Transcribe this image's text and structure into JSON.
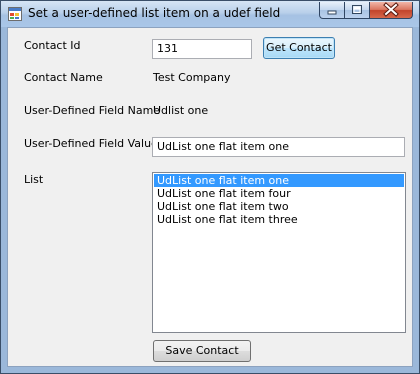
{
  "window": {
    "title": "Set a user-defined list item on a udef field",
    "icon": "app-window-icon"
  },
  "form": {
    "contact_id_label": "Contact Id",
    "contact_id_value": "131",
    "get_contact_label": "Get Contact",
    "contact_name_label": "Contact Name",
    "contact_name_value": "Test Company",
    "udef_name_label": "User-Defined Field Name",
    "udef_name_value": "Udlist one",
    "udef_value_label": "User-Defined Field Value",
    "udef_value_value": "UdList one flat item one",
    "list_label": "List",
    "list_items": [
      "UdList one flat item one",
      "UdList one flat item four",
      "UdList one flat item two",
      "UdList one flat item three"
    ],
    "selected_index": 0,
    "save_contact_label": "Save Contact"
  },
  "colors": {
    "selection": "#3399ff",
    "close_button": "#c2432a"
  }
}
